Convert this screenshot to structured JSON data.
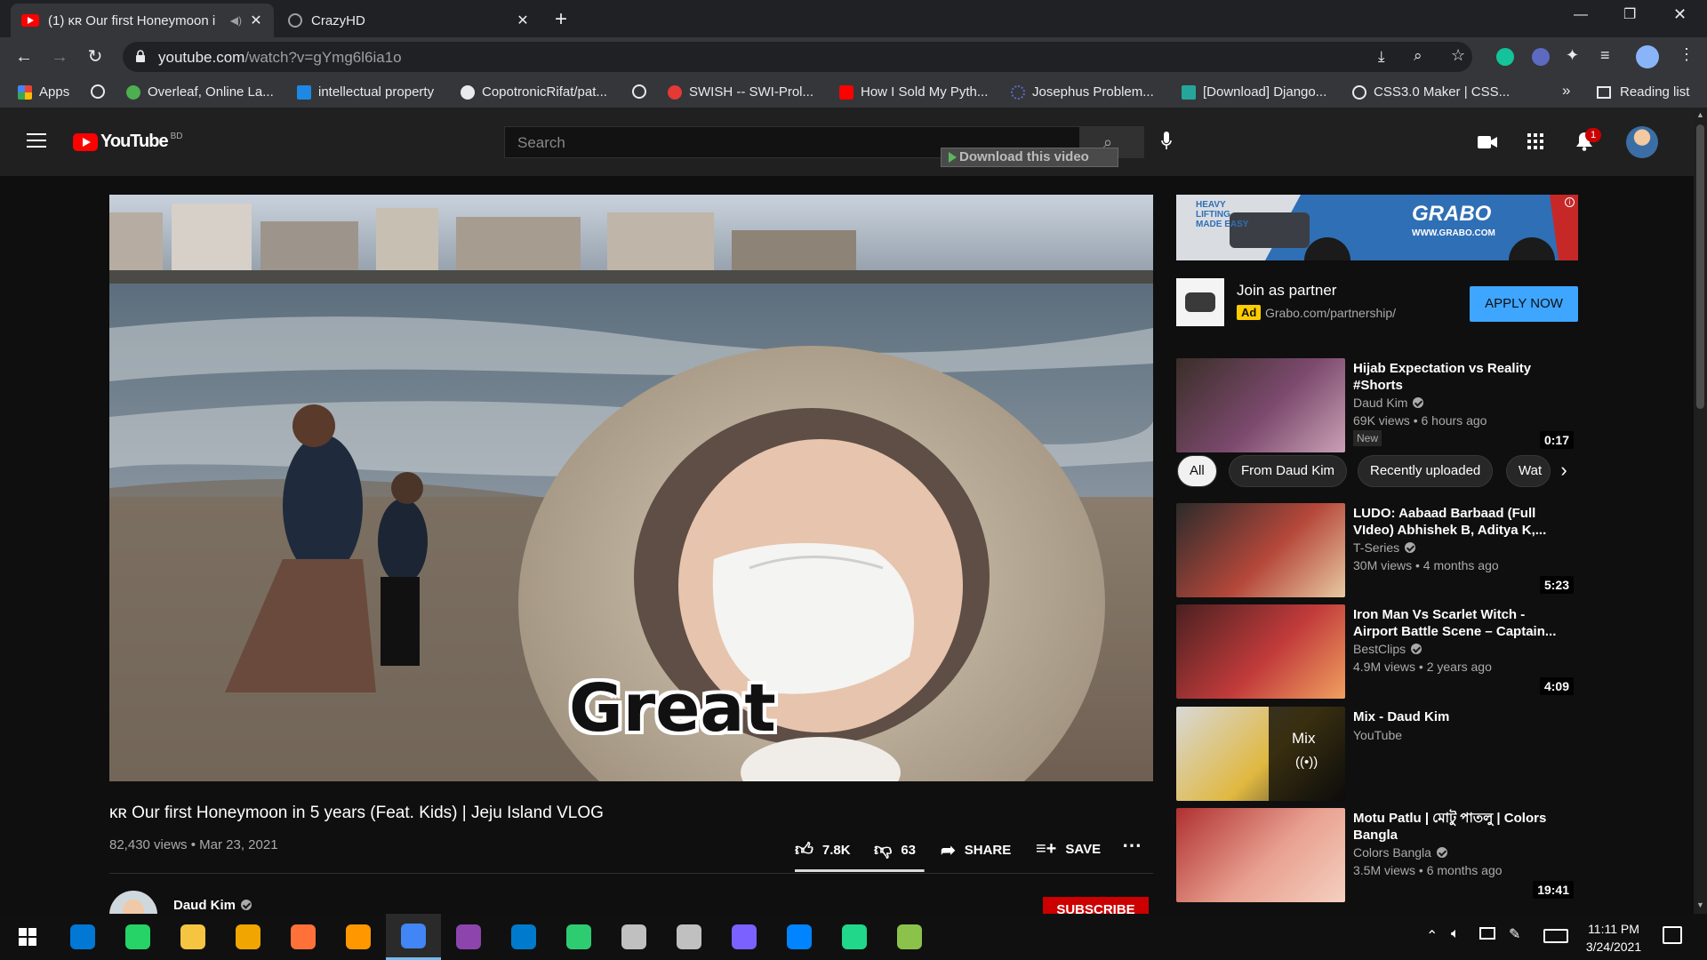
{
  "browser": {
    "tabs": [
      {
        "title": "(1) ᴋʀ Our first Honeymoon i",
        "active": true
      },
      {
        "title": "CrazyHD",
        "active": false
      }
    ],
    "new_tab": "+",
    "url_host": "youtube.com",
    "url_path": "/watch?v=gYmg6l6ia1o",
    "bookmarks": [
      {
        "label": "Apps",
        "color": "#ea4335"
      },
      {
        "label": "",
        "color": "#9aa0a6"
      },
      {
        "label": "Overleaf, Online La...",
        "color": "#4caf50"
      },
      {
        "label": "intellectual property",
        "color": "#1e88e5"
      },
      {
        "label": "CopotronicRifat/pat...",
        "color": "#e8eaed"
      },
      {
        "label": "",
        "color": "#9aa0a6"
      },
      {
        "label": "SWISH -- SWI-Prol...",
        "color": "#e53935"
      },
      {
        "label": "How I Sold My Pyth...",
        "color": "#ff0000"
      },
      {
        "label": "Josephus Problem...",
        "color": "#5c6bc0"
      },
      {
        "label": "[Download] Django...",
        "color": "#26a69a"
      },
      {
        "label": "CSS3.0 Maker | CSS...",
        "color": "#9aa0a6"
      }
    ],
    "bookmarks_more": "»",
    "reading_list": "Reading list"
  },
  "youtube": {
    "logo": "YouTube",
    "country": "BD",
    "search_placeholder": "Search",
    "download_overlay": "Download this video",
    "notification_count": "1"
  },
  "video": {
    "caption": "Great",
    "title": "ᴋʀ Our first Honeymoon in 5 years (Feat. Kids) | Jeju Island VLOG",
    "views": "82,430 views",
    "date": "Mar 23, 2021",
    "likes": "7.8K",
    "dislikes": "63",
    "like_ratio": 0.99,
    "share": "SHARE",
    "save": "SAVE",
    "channel": "Daud Kim",
    "subscribe": "SUBSCRIBE"
  },
  "ad": {
    "banner_brand": "GRABO",
    "banner_tagline": "HEAVY LIFTING MADE EASY",
    "banner_url": "WWW.GRABO.COM",
    "title": "Join as partner",
    "badge": "Ad",
    "domain": "Grabo.com/partnership/",
    "cta": "APPLY NOW"
  },
  "chips": [
    "All",
    "From Daud Kim",
    "Recently uploaded",
    "Wat"
  ],
  "recommendations": [
    {
      "title": "Hijab Expectation vs Reality #Shorts",
      "channel": "Daud Kim",
      "verified": true,
      "stats": "69K views • 6 hours ago",
      "badge": "New",
      "duration": "0:17",
      "colors": [
        "#3a2e28",
        "#7c4a6e",
        "#c9a0b5"
      ]
    },
    {
      "title": "LUDO: Aabaad Barbaad (Full VIdeo) Abhishek B, Aditya K,...",
      "channel": "T-Series",
      "verified": true,
      "stats": "30M views • 4 months ago",
      "badge": "",
      "duration": "5:23",
      "colors": [
        "#2b2b2b",
        "#b5473a",
        "#e8c9a0"
      ]
    },
    {
      "title": "Iron Man Vs Scarlet Witch - Airport Battle Scene – Captain...",
      "channel": "BestClips",
      "verified": true,
      "stats": "4.9M views • 2 years ago",
      "badge": "",
      "duration": "4:09",
      "colors": [
        "#4a2020",
        "#c23b3b",
        "#f0a060"
      ]
    },
    {
      "title": "Mix - Daud Kim",
      "channel": "YouTube",
      "verified": false,
      "stats": "",
      "badge": "",
      "duration": "",
      "mix_label": "Mix",
      "colors": [
        "#d8d8d8",
        "#e0b840",
        "#303030"
      ]
    },
    {
      "title": "Motu Patlu | মোটু পাতলু | Colors Bangla",
      "channel": "Colors Bangla",
      "verified": true,
      "stats": "3.5M views • 6 months ago",
      "badge": "",
      "duration": "19:41",
      "colors": [
        "#b03030",
        "#e8a090",
        "#f5d0c0"
      ]
    }
  ],
  "taskbar": {
    "time": "11:11 PM",
    "date": "3/24/2021",
    "apps": [
      "#0078d4",
      "#25d366",
      "#f5c542",
      "#f0a500",
      "#ff7139",
      "#ff9800",
      "#4285f4",
      "#8e44ad",
      "#007acc",
      "#2ecc71",
      "#c0c0c0",
      "#c0c0c0",
      "#7b61ff",
      "#0084ff",
      "#21d789",
      "#8bc34a"
    ]
  }
}
